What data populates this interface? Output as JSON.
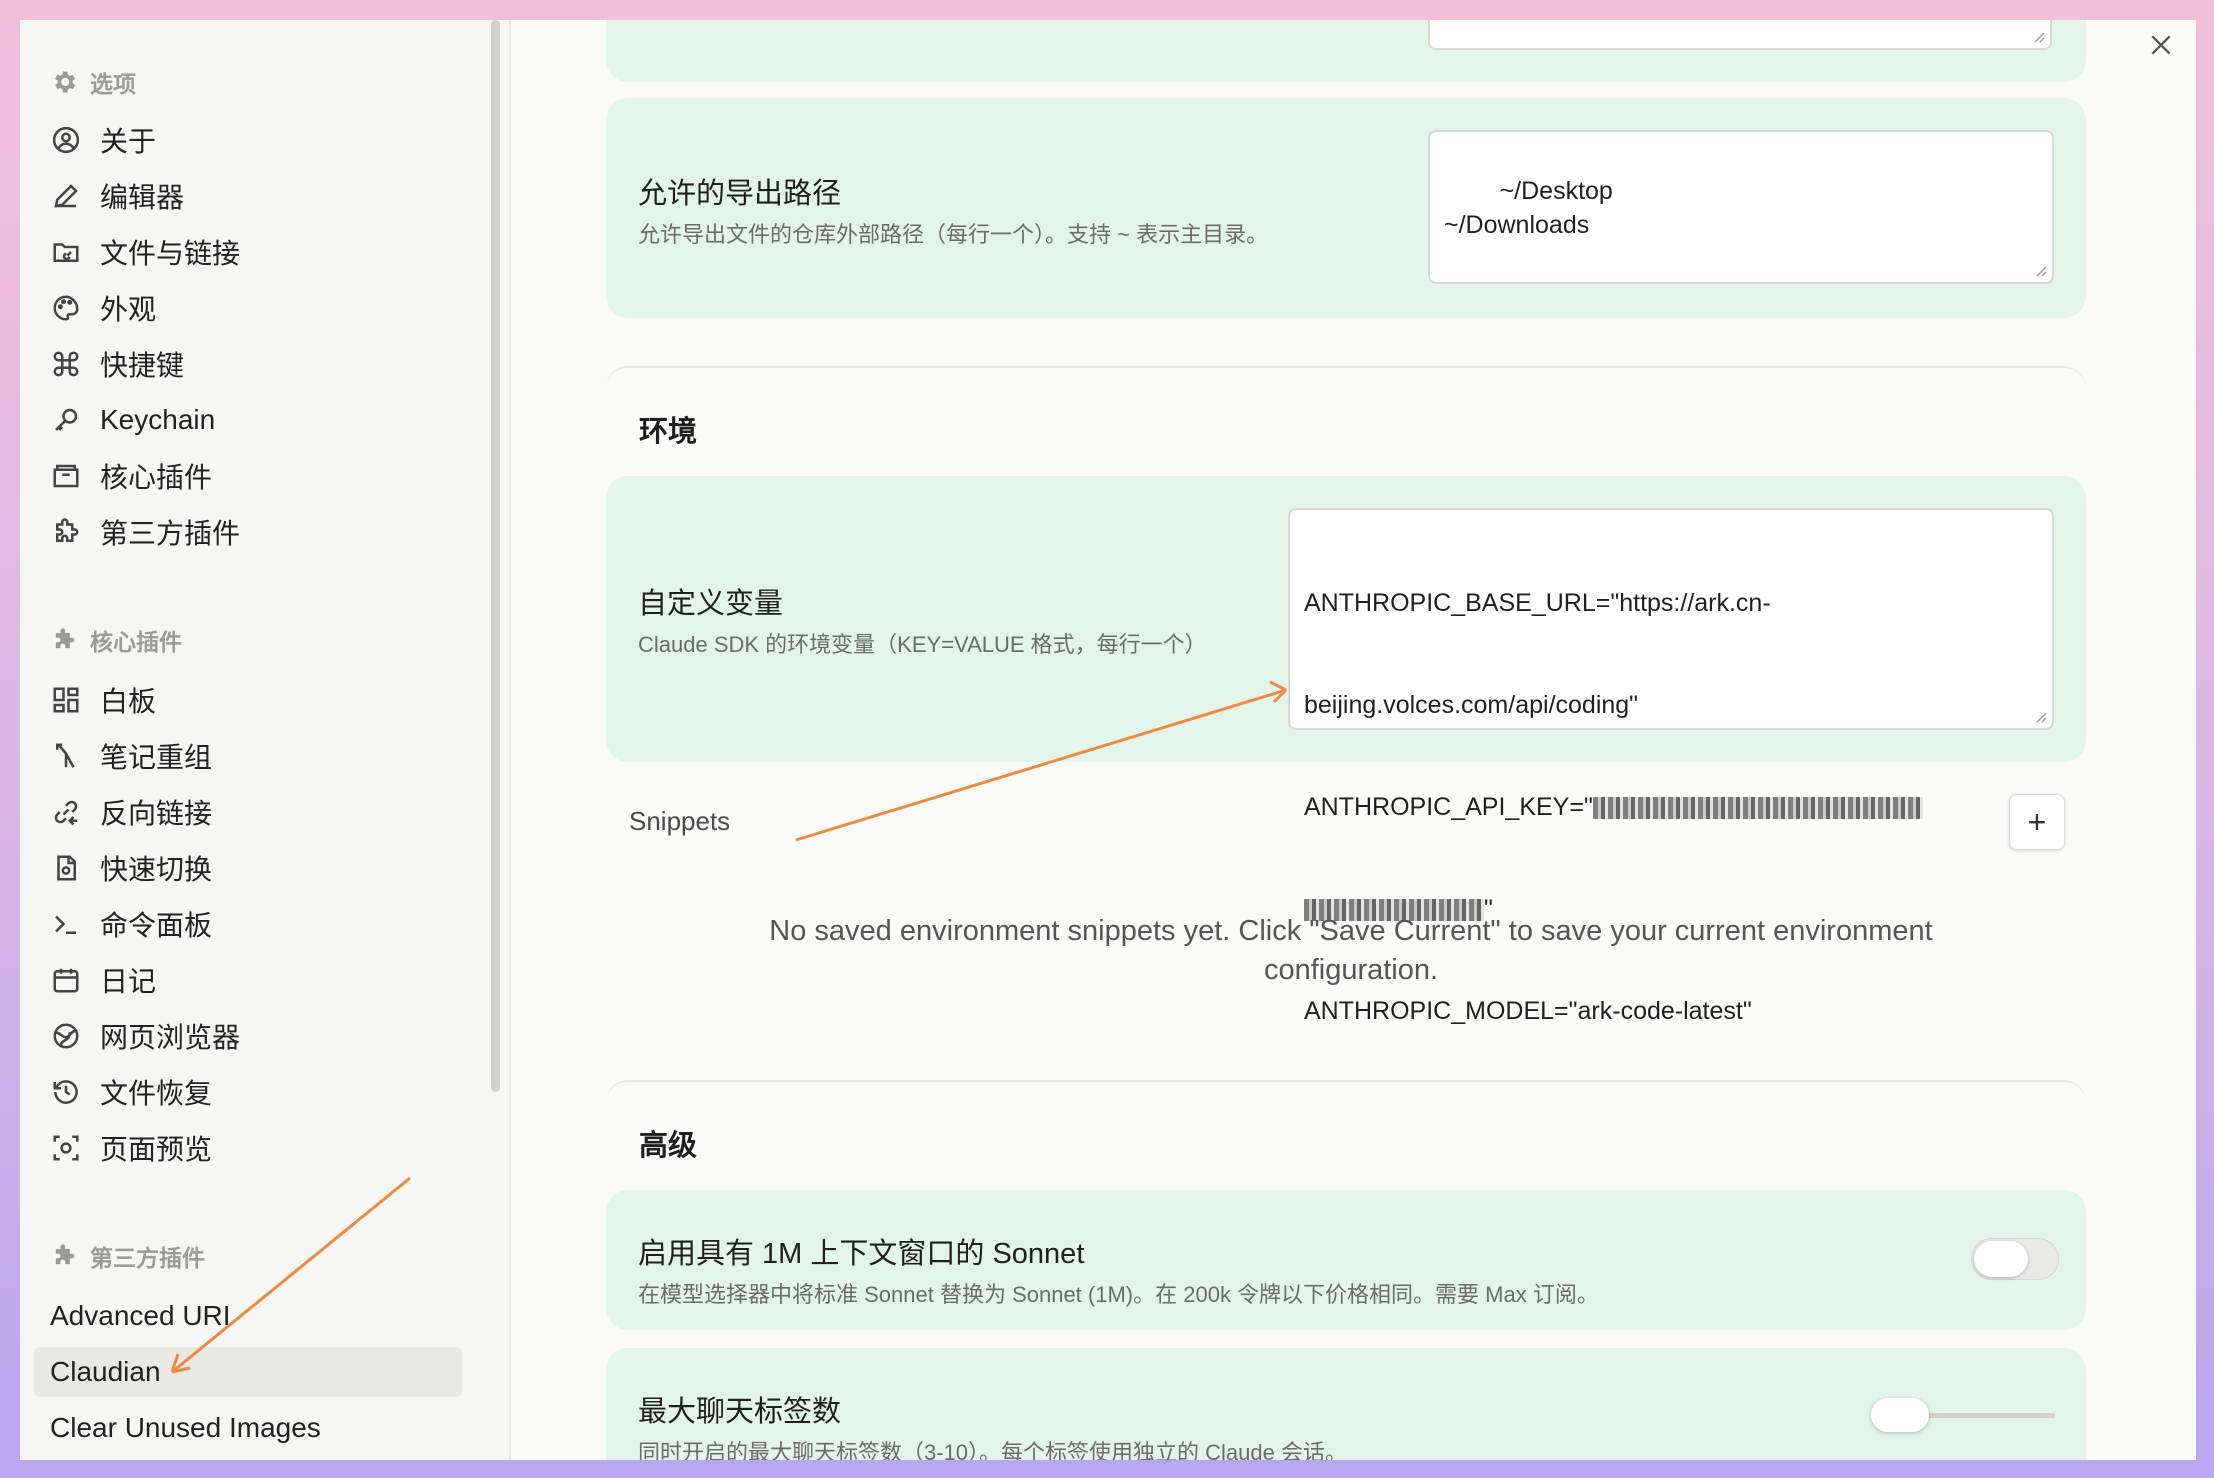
{
  "sidebar": {
    "options_header": "选项",
    "options_items": [
      {
        "label": "关于",
        "icon": "user-circle-icon"
      },
      {
        "label": "编辑器",
        "icon": "pencil-icon"
      },
      {
        "label": "文件与链接",
        "icon": "folder-link-icon"
      },
      {
        "label": "外观",
        "icon": "palette-icon"
      },
      {
        "label": "快捷键",
        "icon": "command-icon"
      },
      {
        "label": "Keychain",
        "icon": "key-icon"
      },
      {
        "label": "核心插件",
        "icon": "box-icon"
      },
      {
        "label": "第三方插件",
        "icon": "puzzle-icon"
      }
    ],
    "core_header": "核心插件",
    "core_items": [
      {
        "label": "白板",
        "icon": "canvas-icon"
      },
      {
        "label": "笔记重组",
        "icon": "merge-icon"
      },
      {
        "label": "反向链接",
        "icon": "backlink-icon"
      },
      {
        "label": "快速切换",
        "icon": "file-switch-icon"
      },
      {
        "label": "命令面板",
        "icon": "terminal-icon"
      },
      {
        "label": "日记",
        "icon": "calendar-icon"
      },
      {
        "label": "网页浏览器",
        "icon": "globe-icon"
      },
      {
        "label": "文件恢复",
        "icon": "history-icon"
      },
      {
        "label": "页面预览",
        "icon": "preview-icon"
      }
    ],
    "third_header": "第三方插件",
    "third_items": [
      {
        "label": "Advanced URI"
      },
      {
        "label": "Claudian",
        "active": true
      },
      {
        "label": "Clear Unused Images"
      }
    ]
  },
  "main": {
    "export_paths": {
      "title": "允许的导出路径",
      "desc": "允许导出文件的仓库外部路径（每行一个）。支持 ~ 表示主目录。",
      "value": "~/Desktop\n~/Downloads"
    },
    "env_section": "环境",
    "custom_vars": {
      "title": "自定义变量",
      "desc": "Claude SDK 的环境变量（KEY=VALUE 格式，每行一个）",
      "line1": "ANTHROPIC_BASE_URL=\"https://ark.cn-",
      "line2": "beijing.volces.com/api/coding\"",
      "line3_prefix": "ANTHROPIC_API_KEY=\"",
      "line4_suffix": "\"",
      "line5": "ANTHROPIC_MODEL=\"ark-code-latest\""
    },
    "snippets_label": "Snippets",
    "add_snippet": "+",
    "snippets_empty": "No saved environment snippets yet. Click \"Save Current\" to save your current environment configuration.",
    "advanced_section": "高级",
    "sonnet_1m": {
      "title": "启用具有 1M 上下文窗口的 Sonnet",
      "desc": "在模型选择器中将标准 Sonnet 替换为 Sonnet (1M)。在 200k 令牌以下价格相同。需要 Max 订阅。",
      "enabled": false
    },
    "max_tabs": {
      "title": "最大聊天标签数",
      "desc": "同时开启的最大聊天标签数（3-10）。每个标签使用独立的 Claude 会话。",
      "slider_fraction": 0.0
    }
  },
  "colors": {
    "card_bg": "#e3f4ea",
    "annotation_arrow": "#ee8a3f",
    "active_item_bg": "#e8e8e4"
  }
}
